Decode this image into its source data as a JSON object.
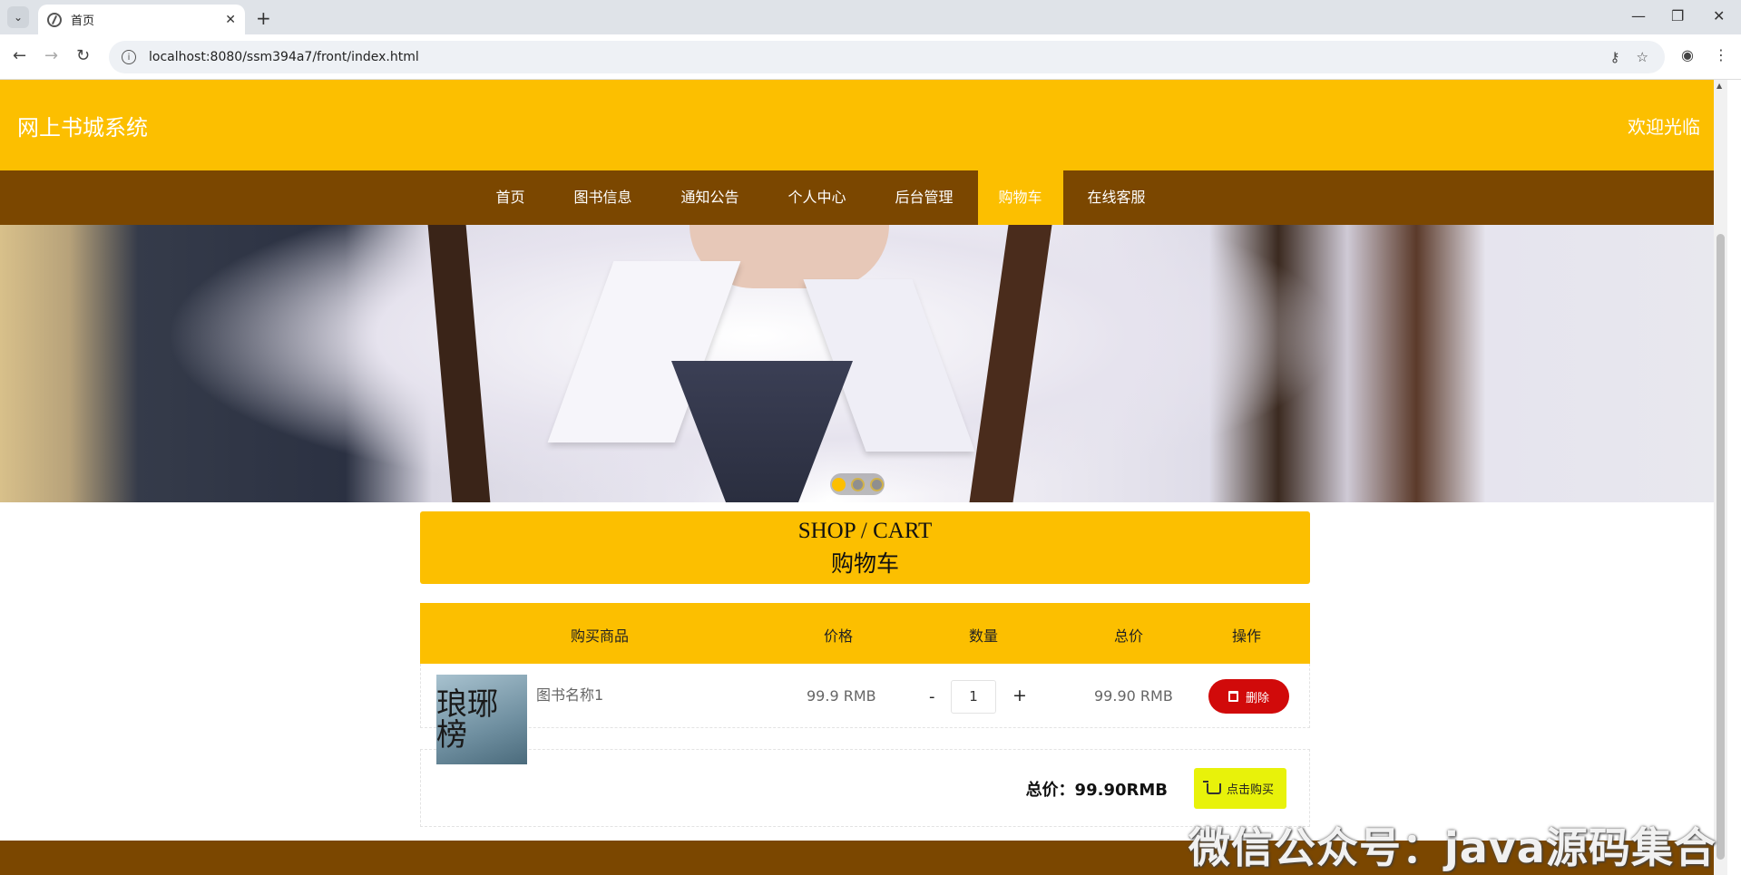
{
  "browser": {
    "tab_title": "首页",
    "tab_close": "✕",
    "new_tab": "+",
    "url": "localhost:8080/ssm394a7/front/index.html",
    "win_min": "—",
    "win_restore": "❐",
    "win_close": "✕"
  },
  "header": {
    "site_title": "网上书城系统",
    "welcome": "欢迎光临"
  },
  "nav": {
    "items": [
      "首页",
      "图书信息",
      "通知公告",
      "个人中心",
      "后台管理",
      "购物车",
      "在线客服"
    ],
    "active": "购物车"
  },
  "banner": {
    "slides": 3,
    "active_slide": 1
  },
  "cart": {
    "title_en": "SHOP / CART",
    "title_cn": "购物车",
    "columns": [
      "购买商品",
      "价格",
      "数量",
      "总价",
      "操作"
    ],
    "items": [
      {
        "cover_text": "琅琊榜",
        "name": "图书名称1",
        "price": "99.9 RMB",
        "minus": "-",
        "quantity": "1",
        "plus": "+",
        "subtotal": "99.90 RMB",
        "delete_label": "删除"
      }
    ],
    "total_label": "总价：99.90RMB",
    "buy_label": "点击购买"
  },
  "watermark": "微信公众号：java源码集合",
  "colors": {
    "primary": "#fcbf00",
    "nav_bg": "#7b4700",
    "delete": "#d10a0a",
    "buy": "#e8f20a"
  }
}
